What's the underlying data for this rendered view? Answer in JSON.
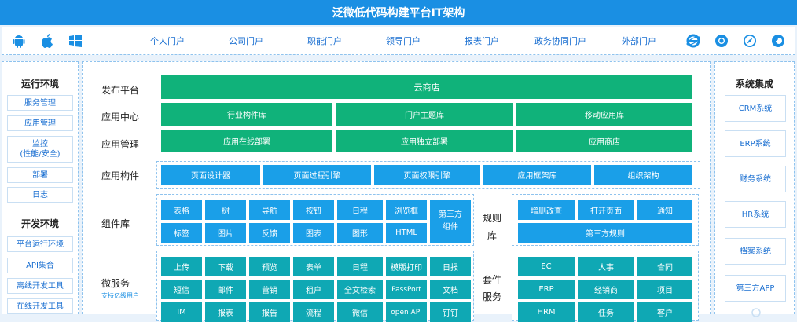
{
  "title": "泛微低代码构建平台IT架构",
  "nav": [
    "个人门户",
    "公司门户",
    "职能门户",
    "领导门户",
    "报表门户",
    "政务协同门户",
    "外部门户"
  ],
  "os_icons": [
    "android-icon",
    "apple-icon",
    "windows-icon"
  ],
  "browser_icons": [
    "ie-icon",
    "chrome-icon",
    "safari-icon",
    "firefox-icon"
  ],
  "left_sidebar": {
    "section1_title": "运行环境",
    "section1_items": [
      "服务管理",
      "应用管理",
      "监控\n(性能/安全)",
      "部署",
      "日志"
    ],
    "section2_title": "开发环境",
    "section2_items": [
      "平台运行环境",
      "API集合",
      "离线开发工具",
      "在线开发工具"
    ]
  },
  "right_sidebar": {
    "title": "系统集成",
    "items": [
      "CRM系统",
      "ERP系统",
      "财务系统",
      "HR系统",
      "档案系统",
      "第三方APP"
    ]
  },
  "rows": {
    "publish": {
      "label": "发布平台",
      "items": [
        "云商店"
      ]
    },
    "appcenter": {
      "label": "应用中心",
      "items": [
        "行业构件库",
        "门户主题库",
        "移动应用库"
      ]
    },
    "appmgmt": {
      "label": "应用管理",
      "items": [
        "应用在线部署",
        "应用独立部署",
        "应用商店"
      ]
    },
    "components": {
      "label": "应用构件",
      "items": [
        "页面设计器",
        "页面过程引擎",
        "页面权限引擎",
        "应用框架库",
        "组织架构"
      ]
    },
    "widgets": {
      "label": "组件库",
      "row1": [
        "表格",
        "树",
        "导航",
        "按钮",
        "日程",
        "浏览框"
      ],
      "row2": [
        "标签",
        "图片",
        "反馈",
        "图表",
        "图形",
        "HTML"
      ],
      "tall": "第三方\n组件",
      "rules_label": "规则\n库",
      "rules_row1": [
        "增删改查",
        "打开页面",
        "通知"
      ],
      "rules_row2": "第三方规则"
    },
    "micro": {
      "label": "微服务",
      "sub": "支持亿级用户",
      "row1": [
        "上传",
        "下载",
        "预览",
        "表单",
        "日程",
        "模版打印",
        "日报"
      ],
      "row2": [
        "短信",
        "邮件",
        "营销",
        "租户",
        "全文检索",
        "PassPort",
        "文档"
      ],
      "row3": [
        "IM",
        "报表",
        "报告",
        "流程",
        "微信",
        "open API",
        "钉钉"
      ],
      "suite_label": "套件\n服务",
      "suite_row1": [
        "EC",
        "人事",
        "合同"
      ],
      "suite_row2": [
        "ERP",
        "经销商",
        "项目"
      ],
      "suite_row3": [
        "HRM",
        "任务",
        "客户"
      ]
    }
  }
}
